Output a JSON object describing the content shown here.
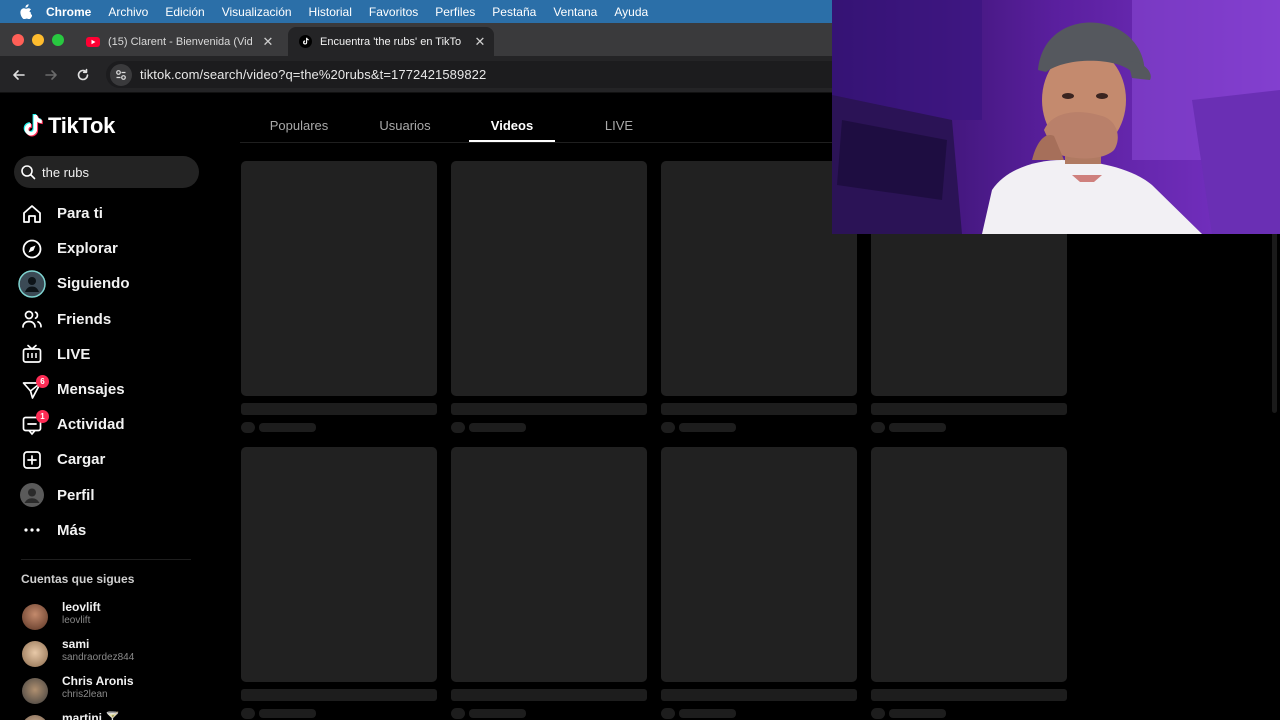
{
  "menubar": {
    "app": "Chrome",
    "items": [
      "Archivo",
      "Edición",
      "Visualización",
      "Historial",
      "Favoritos",
      "Perfiles",
      "Pestaña",
      "Ventana",
      "Ayuda"
    ]
  },
  "tabs": [
    {
      "title": "(15) Clarent - Bienvenida (Vid",
      "close": "✕"
    },
    {
      "title": "Encuentra 'the rubs' en TikTo",
      "close": "✕"
    }
  ],
  "new_tab": "+",
  "address_bar": {
    "url": "tiktok.com/search/video?q=the%20rubs&t=1772421589822"
  },
  "tiktok": {
    "logo": "TikTok",
    "search_value": "the rubs",
    "nav": [
      {
        "label": "Para ti",
        "icon": "home-icon"
      },
      {
        "label": "Explorar",
        "icon": "compass-icon"
      },
      {
        "label": "Siguiendo",
        "icon": "following-avatar-icon"
      },
      {
        "label": "Friends",
        "icon": "friends-icon"
      },
      {
        "label": "LIVE",
        "icon": "live-tv-icon"
      },
      {
        "label": "Mensajes",
        "icon": "send-icon",
        "badge": "6"
      },
      {
        "label": "Actividad",
        "icon": "activity-icon",
        "badge": "1"
      },
      {
        "label": "Cargar",
        "icon": "upload-icon"
      },
      {
        "label": "Perfil",
        "icon": "profile-icon"
      },
      {
        "label": "Más",
        "icon": "more-icon"
      }
    ],
    "following_title": "Cuentas que sigues",
    "accounts": [
      {
        "name": "leovlift",
        "handle": "leovlift"
      },
      {
        "name": "sami",
        "handle": "sandraordez844"
      },
      {
        "name": "Chris Aronis",
        "handle": "chris2lean"
      },
      {
        "name": "martini 🍸",
        "handle": ""
      }
    ],
    "result_tabs": [
      "Populares",
      "Usuarios",
      "Videos",
      "LIVE"
    ],
    "active_tab": "Videos",
    "loading_cards": 8
  },
  "colors": {
    "menubar": "#2b6fa8",
    "accent": "#fe2c55",
    "skeleton": "#212121"
  }
}
